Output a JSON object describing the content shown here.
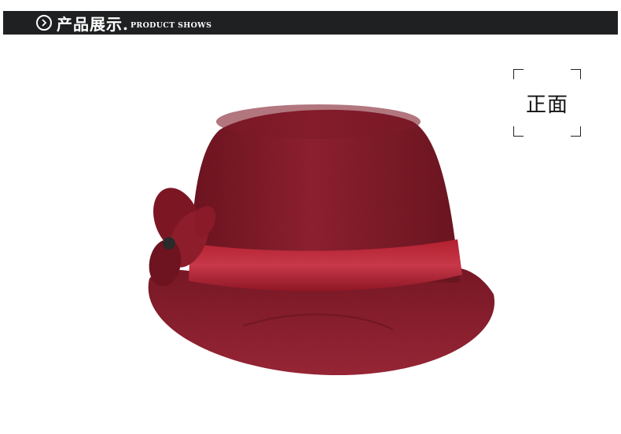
{
  "header": {
    "title_cn": "产品展示.",
    "title_en": "PRODUCT SHOWS",
    "bar_color": "#1f2021"
  },
  "view_label": "正面",
  "product": {
    "hat_color": "#8b1e2b",
    "ribbon_color": "#a3182a"
  }
}
